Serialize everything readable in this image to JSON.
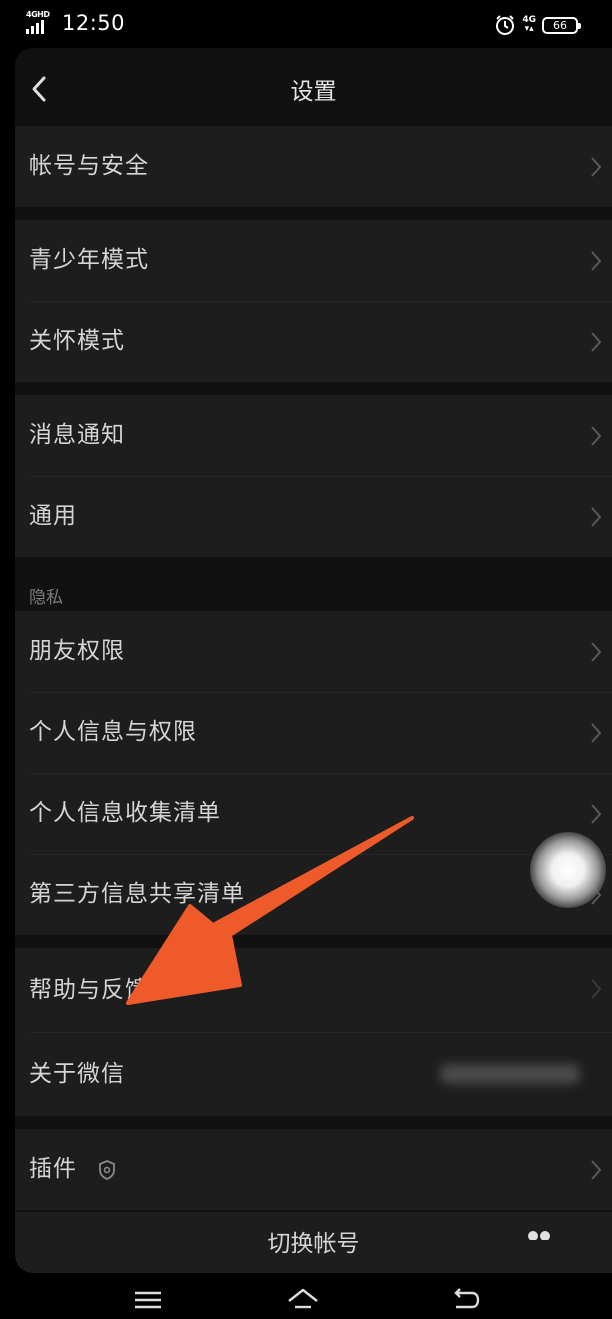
{
  "status_bar": {
    "network": "4GHD",
    "time": "12:50",
    "mobile_data": "4G",
    "battery": "66"
  },
  "header": {
    "title": "设置"
  },
  "groups": {
    "account": [
      "帐号与安全"
    ],
    "modes": [
      "青少年模式",
      "关怀模式"
    ],
    "general": [
      "消息通知",
      "通用"
    ],
    "privacy_section_label": "隐私",
    "privacy": [
      "朋友权限",
      "个人信息与权限",
      "个人信息收集清单",
      "第三方信息共享清单"
    ],
    "help": [
      "帮助与反馈",
      "关于微信"
    ],
    "plugins": [
      "插件"
    ]
  },
  "footer": {
    "switch_account": "切换帐号"
  },
  "colors": {
    "background": "#000000",
    "panel": "#111111",
    "row": "#1d1d1d",
    "text": "#d5d5d5",
    "annotation_arrow": "#ee5a2a"
  }
}
